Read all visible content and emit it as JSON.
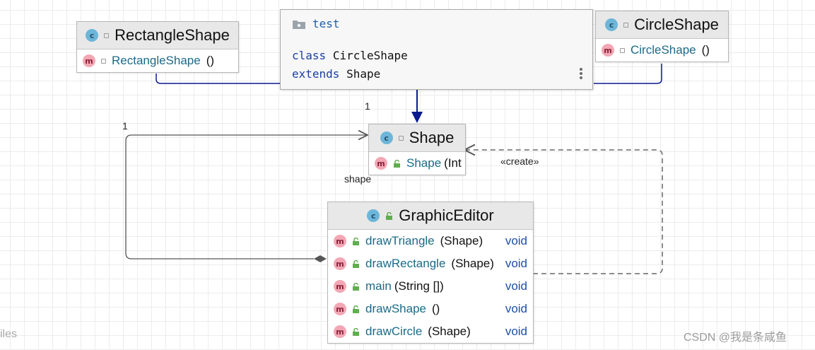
{
  "colors": {
    "class_badge": "#6db6d9",
    "method_badge": "#f3a7b4",
    "method_name": "#1b6a86",
    "return_type": "#1f4ea8",
    "inheritance_arrow": "#0b1a8f",
    "header_bg": "#e8e8e8"
  },
  "icons": {
    "class_badge_letter": "c",
    "method_badge_letter": "m"
  },
  "classes": {
    "rectangle_shape": {
      "title": "RectangleShape",
      "methods": [
        {
          "name": "RectangleShape",
          "args": "()",
          "return": ""
        }
      ]
    },
    "circle_shape": {
      "title": "CircleShape",
      "methods": [
        {
          "name": "CircleShape",
          "args": "()",
          "return": ""
        }
      ]
    },
    "shape": {
      "title": "Shape",
      "methods": [
        {
          "name": "Shape",
          "args": "(Int",
          "return": ""
        }
      ]
    },
    "graphic_editor": {
      "title": "GraphicEditor",
      "methods": [
        {
          "name": "drawTriangle",
          "args": "(Shape)",
          "return": "void"
        },
        {
          "name": "drawRectangle",
          "args": "(Shape)",
          "return": "void"
        },
        {
          "name": "main",
          "args": "(String [])",
          "return": "void"
        },
        {
          "name": "drawShape",
          "args": "()",
          "return": "void"
        },
        {
          "name": "drawCircle",
          "args": "(Shape)",
          "return": "void"
        }
      ]
    }
  },
  "tooltip": {
    "package": "test",
    "line1_keyword": "class",
    "line1_name": "CircleShape",
    "line2_keyword": "extends",
    "line2_name": "Shape"
  },
  "edge_labels": {
    "multiplicity_left": "1",
    "multiplicity_top": "1",
    "role": "shape",
    "create": "«create»"
  },
  "edge_text": "iles",
  "watermark": "CSDN @我是条咸鱼"
}
